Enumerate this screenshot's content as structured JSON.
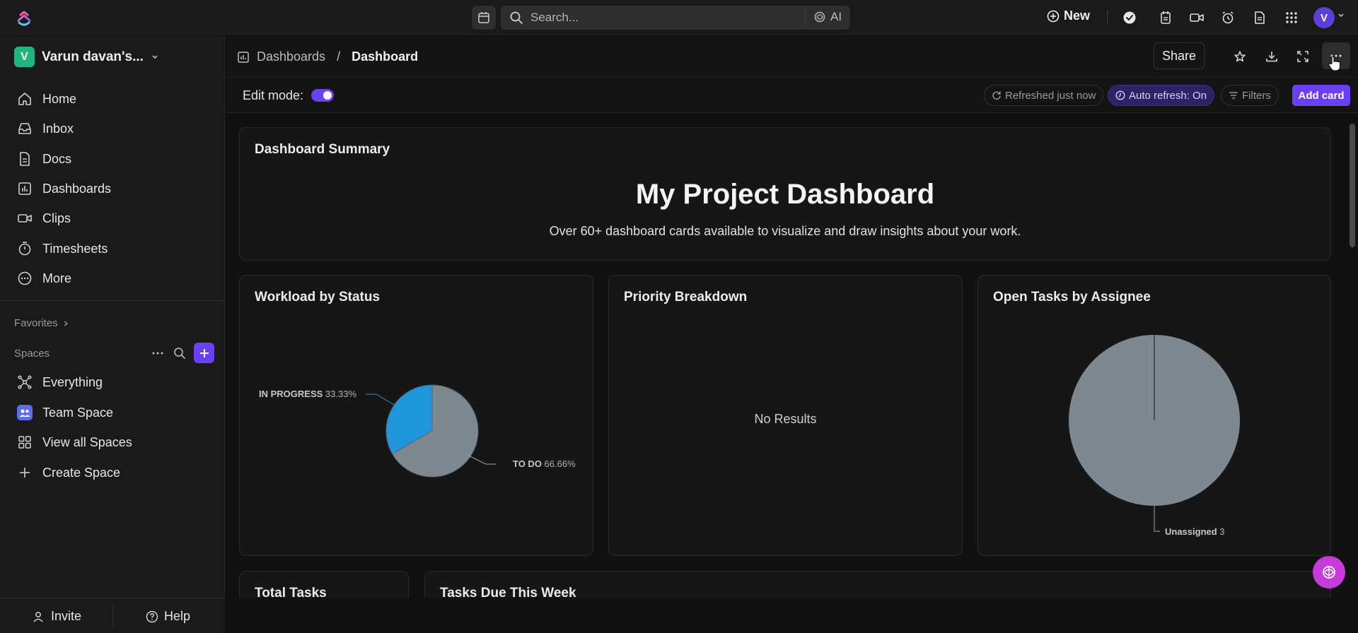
{
  "topbar": {
    "search_placeholder": "Search...",
    "ai_label": "AI",
    "new_label": "New",
    "avatar_initial": "V"
  },
  "sidebar": {
    "workspace_initial": "V",
    "workspace_name": "Varun davan's...",
    "nav": [
      {
        "label": "Home",
        "icon": "home-icon"
      },
      {
        "label": "Inbox",
        "icon": "inbox-icon"
      },
      {
        "label": "Docs",
        "icon": "docs-icon"
      },
      {
        "label": "Dashboards",
        "icon": "dashboards-icon"
      },
      {
        "label": "Clips",
        "icon": "clips-icon"
      },
      {
        "label": "Timesheets",
        "icon": "timesheets-icon"
      },
      {
        "label": "More",
        "icon": "more-icon"
      }
    ],
    "favorites_label": "Favorites",
    "spaces_label": "Spaces",
    "spaces": [
      {
        "label": "Everything",
        "icon": "everything-icon"
      },
      {
        "label": "Team Space",
        "icon": "team-space-icon"
      },
      {
        "label": "View all Spaces",
        "icon": "grid-icon"
      },
      {
        "label": "Create Space",
        "icon": "plus-icon"
      }
    ],
    "invite_label": "Invite",
    "help_label": "Help"
  },
  "header": {
    "breadcrumb_parent": "Dashboards",
    "breadcrumb_separator": "/",
    "breadcrumb_current": "Dashboard",
    "share_label": "Share"
  },
  "editbar": {
    "edit_mode_label": "Edit mode:",
    "edit_mode_on": true,
    "refreshed_label": "Refreshed just now",
    "auto_refresh_label": "Auto refresh: On",
    "filters_label": "Filters",
    "add_card_label": "Add card"
  },
  "cards": {
    "summary": {
      "title": "Dashboard Summary",
      "heading": "My Project Dashboard",
      "subtitle": "Over 60+ dashboard cards available to visualize and draw insights about your work."
    },
    "workload": {
      "title": "Workload by Status"
    },
    "priority": {
      "title": "Priority Breakdown",
      "empty_text": "No Results"
    },
    "assignee": {
      "title": "Open Tasks by Assignee"
    },
    "total": {
      "title": "Total Tasks"
    },
    "due": {
      "title": "Tasks Due This Week"
    }
  },
  "chart_data": [
    {
      "type": "pie",
      "title": "Workload by Status",
      "slices": [
        {
          "label": "IN PROGRESS",
          "value": 33.33,
          "value_label": "33.33%",
          "color": "#1e96dc"
        },
        {
          "label": "TO DO",
          "value": 66.66,
          "value_label": "66.66%",
          "color": "#7e8891"
        }
      ]
    },
    {
      "type": "pie",
      "title": "Open Tasks by Assignee",
      "slices": [
        {
          "label": "Unassigned",
          "value": 3,
          "value_label": "3",
          "color": "#7e8891"
        }
      ]
    }
  ],
  "colors": {
    "accent": "#6b3ff2",
    "workspace_badge": "#1fb57c",
    "fab": "#c73bdb"
  }
}
